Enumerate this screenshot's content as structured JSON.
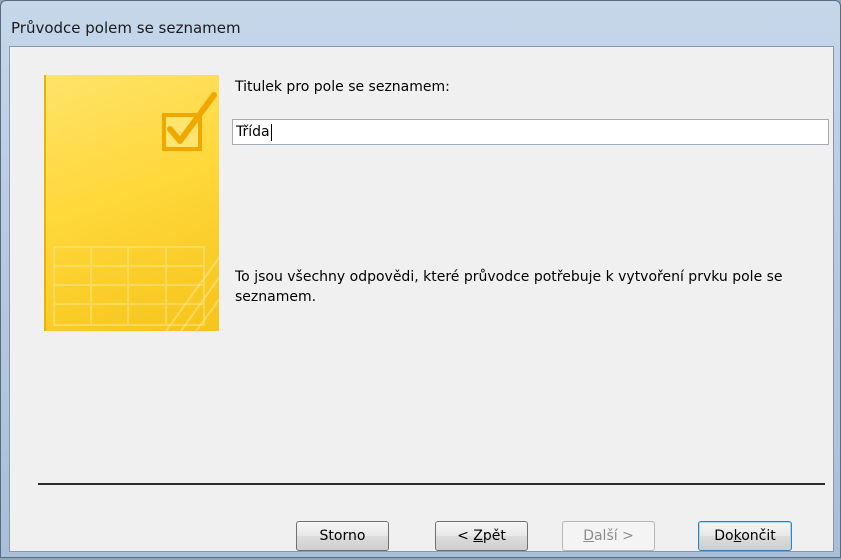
{
  "window": {
    "title": "Průvodce polem se seznamem"
  },
  "main": {
    "caption_label": "Titulek pro pole se seznamem:",
    "caption_value": "Třída",
    "info_text": "To jsou všechny odpovědi, které průvodce potřebuje k vytvoření prvku pole se seznamem."
  },
  "buttons": {
    "cancel": "Storno",
    "back_prefix": "< ",
    "back_mnemonic": "Z",
    "back_rest": "pět",
    "next_mnemonic": "D",
    "next_rest": "alší >",
    "finish_prefix": "Do",
    "finish_mnemonic": "k",
    "finish_rest": "ončit"
  },
  "colors": {
    "accent_yellow": "#ffd83b",
    "hero_border": "#e8b400",
    "default_button_border": "#3c7fb1"
  },
  "icons": {
    "hero": "checkbox-check-icon"
  }
}
